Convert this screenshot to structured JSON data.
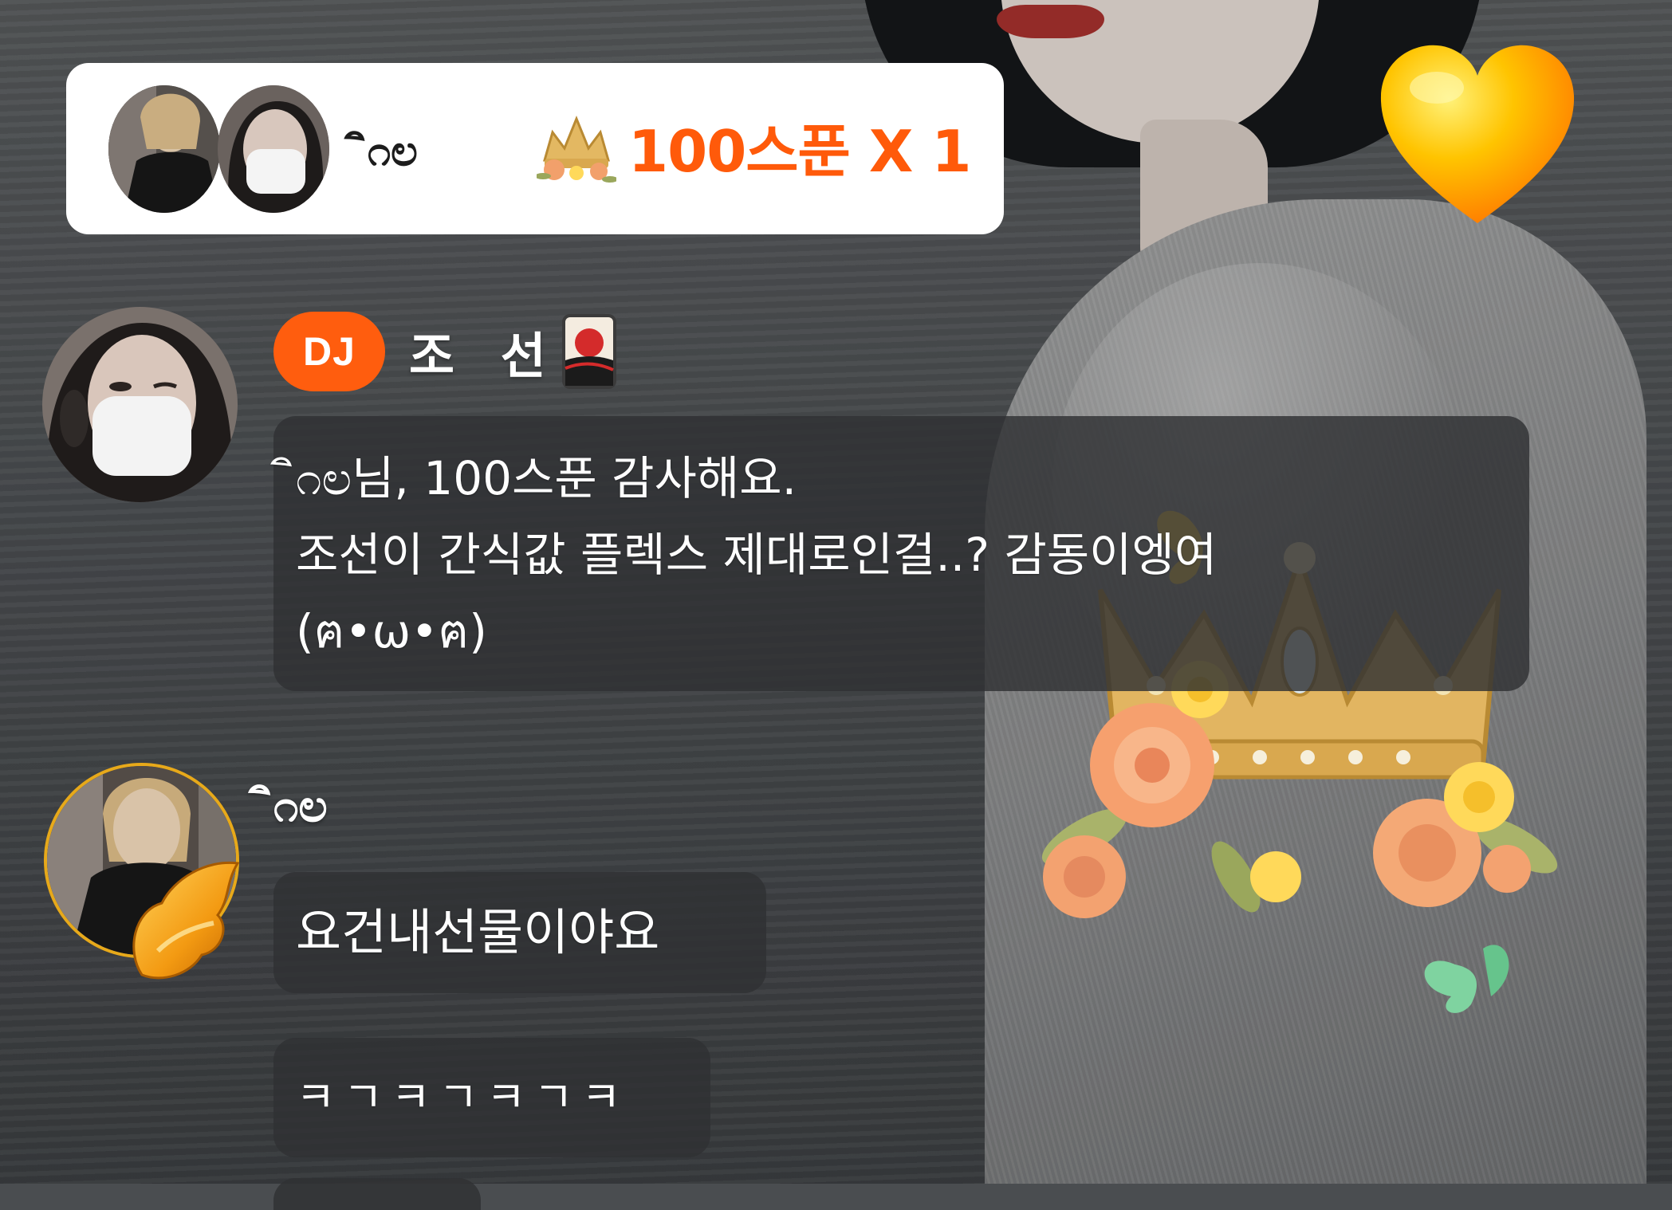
{
  "gift_notification": {
    "sender": "‌ิ೧ಲ",
    "amount": "100스푼 X 1",
    "gift_icon": "crown-gift-icon"
  },
  "chat": {
    "dj_message": {
      "badge": "DJ",
      "name": "조 선",
      "name_icon": "hanafuda-card-icon",
      "lines": [
        "‌ิ೧ಲ님, 100스푼 감사해요.",
        "조선이 간식값 플렉스 제대로인걸..? 감동이엥여",
        "(ฅ•ω•ฅ)"
      ]
    },
    "user_message": {
      "name": "‌ิ೧ಲ",
      "badge_icon": "gold-wing-icon",
      "bubbles": [
        "요건내선물이야요",
        "ㅋㄱㅋㄱㅋㄱㅋ"
      ]
    }
  },
  "overlays": {
    "heart_icon": "heart-icon",
    "crown_decoration": "crown-flowers-icon",
    "heart_color": "#ffb400",
    "accent": "#ff5a0a"
  }
}
